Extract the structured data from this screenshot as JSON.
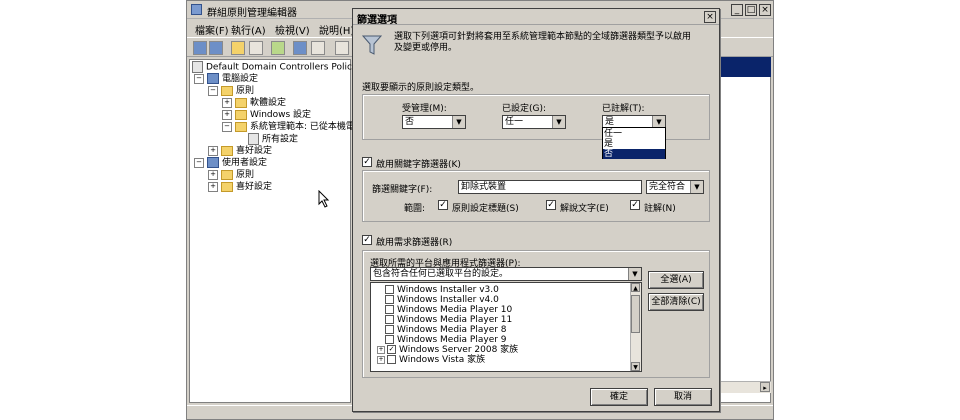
{
  "mmc": {
    "title": "群組原則管理編輯器",
    "menu": [
      "檔案(F)",
      "執行(A)",
      "檢視(V)",
      "說明(H)"
    ],
    "tree": [
      {
        "label": "Default Domain Controllers Policy [WIN-",
        "indent": 0
      },
      {
        "label": "電腦設定",
        "indent": 1,
        "exp": "−"
      },
      {
        "label": "原則",
        "indent": 2,
        "exp": "−"
      },
      {
        "label": "軟體設定",
        "indent": 3,
        "exp": "+"
      },
      {
        "label": "Windows 設定",
        "indent": 3,
        "exp": "+"
      },
      {
        "label": "系統管理範本: 已從本機電",
        "indent": 3,
        "exp": "−"
      },
      {
        "label": "所有設定",
        "indent": 4
      },
      {
        "label": "喜好設定",
        "indent": 2,
        "exp": "+"
      },
      {
        "label": "使用者設定",
        "indent": 1,
        "exp": "−"
      },
      {
        "label": "原則",
        "indent": 2,
        "exp": "+"
      },
      {
        "label": "喜好設定",
        "indent": 2,
        "exp": "+"
      }
    ]
  },
  "dialog": {
    "title": "篩選選項",
    "description": "選取下列選項可針對將套用至系統管理範本節點的全域篩選器類型予以啟用及變更或停用。",
    "setting_types_label": "選取要顯示的原則設定類型。",
    "managed_label": "受管理(M):",
    "managed_value": "否",
    "configured_label": "已設定(G):",
    "configured_value": "任一",
    "commented_label": "已註解(T):",
    "commented_value": "是",
    "commented_options": [
      "任一",
      "是",
      "否"
    ],
    "keyword_enable_label": "啟用關鍵字篩選器(K)",
    "keyword_label": "篩選關鍵字(F):",
    "keyword_value": "卸除式裝置",
    "match_value": "完全符合",
    "scope_label": "範圍:",
    "scope_title": "原則設定標題(S)",
    "scope_explain": "解說文字(E)",
    "scope_comment": "註解(N)",
    "req_enable_label": "啟用需求篩選器(R)",
    "platform_label": "選取所需的平台與應用程式篩選器(P):",
    "platform_mode": "包含符合任何已選取平台的設定。",
    "platforms": [
      {
        "label": "Windows Installer v3.0",
        "checked": false
      },
      {
        "label": "Windows Installer v4.0",
        "checked": false
      },
      {
        "label": "Windows Media Player 10",
        "checked": false
      },
      {
        "label": "Windows Media Player 11",
        "checked": false
      },
      {
        "label": "Windows Media Player 8",
        "checked": false
      },
      {
        "label": "Windows Media Player 9",
        "checked": false
      },
      {
        "label": "Windows Server 2008 家族",
        "checked": true,
        "expand": true
      },
      {
        "label": "Windows Vista 家族",
        "checked": false,
        "expand": true
      }
    ],
    "select_all": "全選(A)",
    "clear_all": "全部清除(C)",
    "ok": "確定",
    "cancel": "取消"
  }
}
